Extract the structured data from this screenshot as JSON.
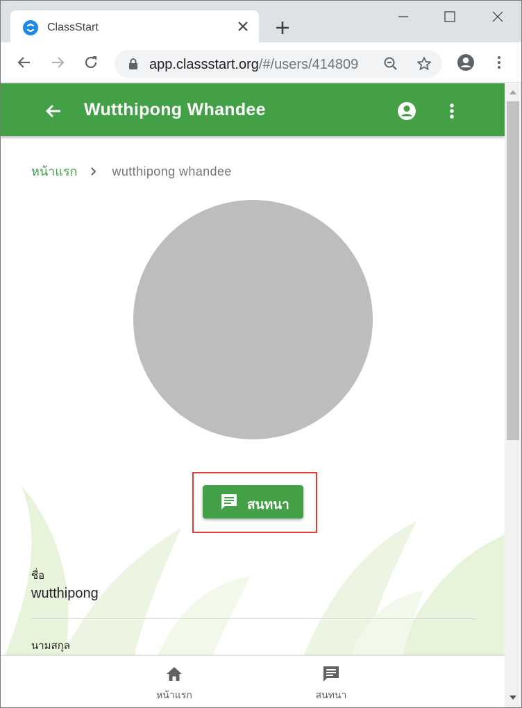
{
  "browser": {
    "tab_title": "ClassStart",
    "url_host": "app.classstart.org",
    "url_path": "/#/users/414809"
  },
  "appbar": {
    "title": "Wutthipong Whandee",
    "color": "#43a047"
  },
  "breadcrumb": {
    "home": "หน้าแรก",
    "current": "wutthipong whandee"
  },
  "chat_button": {
    "label": "สนทนา",
    "icon": "chat-icon"
  },
  "fields": {
    "first_name_label": "ชื่อ",
    "first_name_value": "wutthipong",
    "last_name_label": "นามสกุล"
  },
  "bottom_nav": {
    "home_label": "หน้าแรก",
    "home_icon": "home-icon",
    "chat_label": "สนทนา",
    "chat_icon": "chat-icon"
  },
  "highlight_color": "#e53935"
}
